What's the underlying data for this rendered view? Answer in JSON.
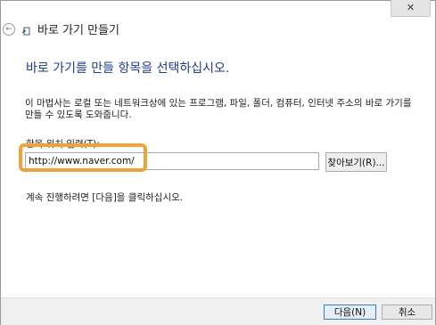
{
  "window": {
    "title": "바로 가기 만들기",
    "close_label": "✕"
  },
  "wizard": {
    "heading": "바로 가기를 만들 항목을 선택하십시오.",
    "description": "이 마법사는 로컬 또는 네트워크상에 있는 프로그램, 파일, 폴더, 컴퓨터, 인터넷 주소의 바로 가기를 만들 수 있도록 도와줍니다.",
    "location_label": "항목 위치 입력(T):",
    "location_value": "http://www.naver.com/",
    "browse_label": "찾아보기(R)...",
    "hint": "계속 진행하려면 [다음]을 클릭하십시오."
  },
  "footer": {
    "next_label": "다음(N)",
    "cancel_label": "취소"
  },
  "colors": {
    "heading": "#1e3d8c",
    "highlight": "#f0a33a"
  },
  "icons": {
    "back": "back-arrow-icon",
    "wizard": "shortcut-wizard-icon"
  }
}
